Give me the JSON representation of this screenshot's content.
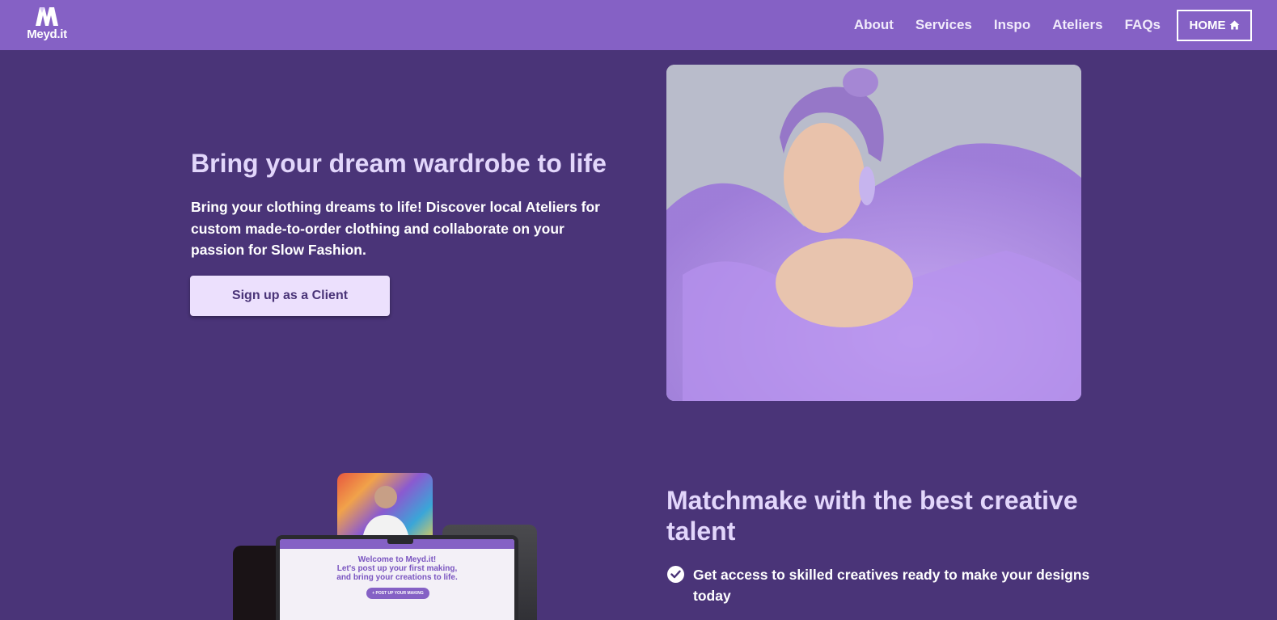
{
  "brand": {
    "name": "Meyd.it"
  },
  "nav": {
    "links": [
      "About",
      "Services",
      "Inspo",
      "Ateliers",
      "FAQs"
    ],
    "home_label": "HOME"
  },
  "hero": {
    "title": "Bring your dream wardrobe to life",
    "description": "Bring your clothing dreams to life! Discover local Ateliers for custom made-to-order clothing and collaborate on your passion for Slow Fashion.",
    "cta_label": "Sign up as a Client"
  },
  "mockup": {
    "welcome_line1": "Welcome to Meyd.it!",
    "welcome_line2": "Let's post up your first making,",
    "welcome_line3": "and bring your creations to life.",
    "button_label": "+ POST UP YOUR MAKING"
  },
  "section2": {
    "title": "Matchmake with the best creative talent",
    "features": [
      "Get access to skilled creatives ready to make your designs today"
    ]
  },
  "colors": {
    "background": "#4a3478",
    "navbar": "#8561c5",
    "heading": "#e2d6fb",
    "button_bg": "#ece0fd"
  }
}
